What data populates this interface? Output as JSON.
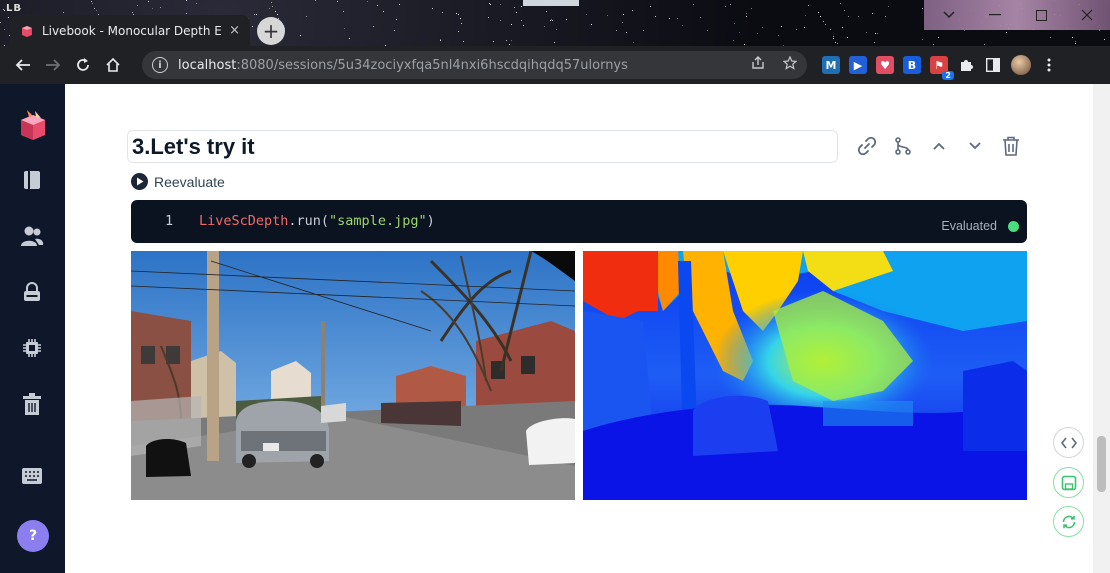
{
  "browser": {
    "logo_text": "LB",
    "tab_title": "Livebook - Monocular Depth Esti",
    "tab_close": "×",
    "new_tab": "+",
    "url_host": "localhost",
    "url_rest": ":8080/sessions/5u34zociyxfqa5nl4nxi6hscdqihqdq57ulornys",
    "extensions": [
      {
        "icon": "m-extension-icon",
        "label": "M",
        "color": "#1f6fb3"
      },
      {
        "icon": "play-extension-icon",
        "label": "▶",
        "color": "#2260d9"
      },
      {
        "icon": "pocket-extension-icon",
        "label": "♥",
        "color": "#e14d62"
      },
      {
        "icon": "bitwarden-extension-icon",
        "label": "B",
        "color": "#175ddc",
        "badge": ""
      },
      {
        "icon": "flag-extension-icon",
        "label": "⚑",
        "color": "#d84242",
        "badge": "2"
      }
    ]
  },
  "sidebar": {
    "items": [
      {
        "name": "livebook-logo-icon"
      },
      {
        "name": "notebooks-icon"
      },
      {
        "name": "users-icon"
      },
      {
        "name": "secrets-icon"
      },
      {
        "name": "runtime-icon"
      },
      {
        "name": "bin-icon"
      },
      {
        "name": "shortcuts-icon"
      }
    ],
    "help_label": "?"
  },
  "cell": {
    "heading": "3.Let's try it",
    "reevaluate_label": "Reevaluate",
    "line_number": "1",
    "code_module": "LiveScDepth",
    "code_call": ".run(",
    "code_string": "\"sample.jpg\"",
    "code_close": ")",
    "status_label": "Evaluated",
    "status_color": "#4ade80"
  },
  "colors": {
    "sidebar_bg": "#0f182a",
    "code_bg": "#0b1220",
    "accent_green": "#4ade80",
    "help_purple": "#8b7ff0"
  }
}
